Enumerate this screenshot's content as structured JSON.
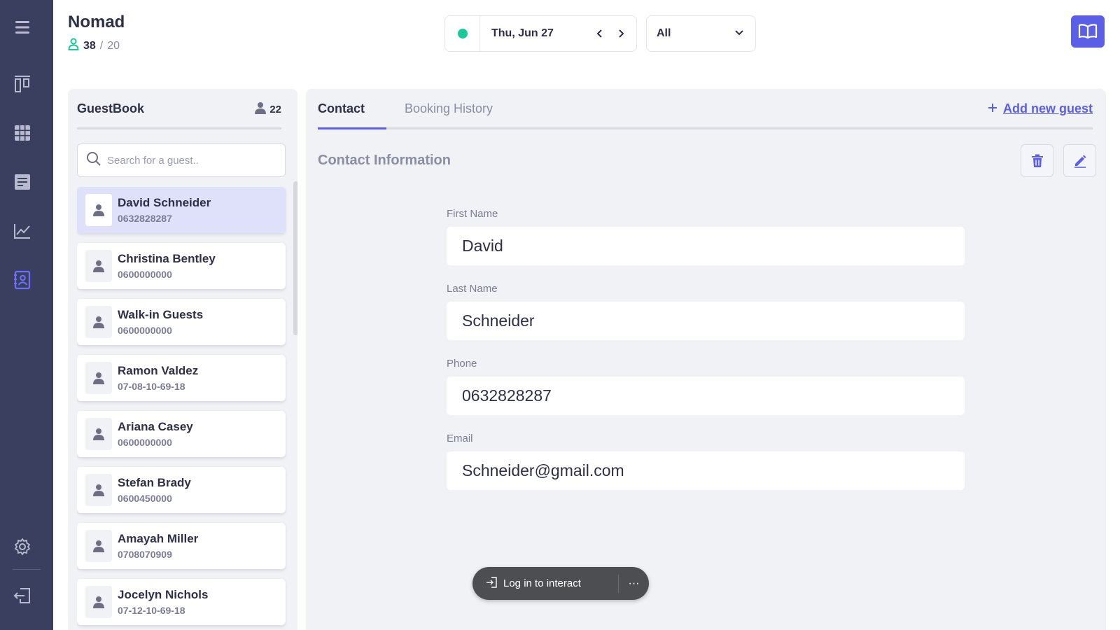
{
  "app": {
    "title": "Nomad",
    "occupancy_current": "38",
    "occupancy_separator": "/",
    "occupancy_total": "20"
  },
  "header": {
    "date": "Thu, Jun 27",
    "filter": "All",
    "status_color": "#1cc79a"
  },
  "sidebar": {
    "items": [
      {
        "icon": "menu-icon"
      },
      {
        "icon": "board-icon"
      },
      {
        "icon": "grid-icon"
      },
      {
        "icon": "report-icon"
      },
      {
        "icon": "chart-icon"
      },
      {
        "icon": "guestbook-icon",
        "active": true
      },
      {
        "icon": "gear-icon"
      },
      {
        "icon": "logout-icon"
      }
    ]
  },
  "guestbook": {
    "title": "GuestBook",
    "count": "22",
    "search_placeholder": "Search for a guest..",
    "guests": [
      {
        "name": "David Schneider",
        "phone": "0632828287",
        "selected": true
      },
      {
        "name": "Christina Bentley",
        "phone": "0600000000"
      },
      {
        "name": "Walk-in Guests",
        "phone": "0600000000"
      },
      {
        "name": "Ramon Valdez",
        "phone": "07-08-10-69-18"
      },
      {
        "name": "Ariana Casey",
        "phone": "0600000000"
      },
      {
        "name": "Stefan Brady",
        "phone": "0600450000"
      },
      {
        "name": "Amayah Miller",
        "phone": "0708070909"
      },
      {
        "name": "Jocelyn Nichols",
        "phone": "07-12-10-69-18"
      }
    ]
  },
  "main": {
    "tabs": [
      {
        "label": "Contact",
        "active": true
      },
      {
        "label": "Booking History"
      }
    ],
    "add_guest_label": "Add new guest",
    "section_title": "Contact Information",
    "fields": {
      "first_name_label": "First Name",
      "first_name_value": "David",
      "last_name_label": "Last Name",
      "last_name_value": "Schneider",
      "phone_label": "Phone",
      "phone_value": "0632828287",
      "email_label": "Email",
      "email_value": "Schneider@gmail.com"
    }
  },
  "login_prompt": {
    "label": "Log in to interact",
    "more": "···"
  },
  "colors": {
    "sidebar_bg": "#3b3f5f",
    "accent": "#5b5fe6",
    "status_green": "#1cc79a",
    "panel_bg": "#f1f2f6"
  }
}
